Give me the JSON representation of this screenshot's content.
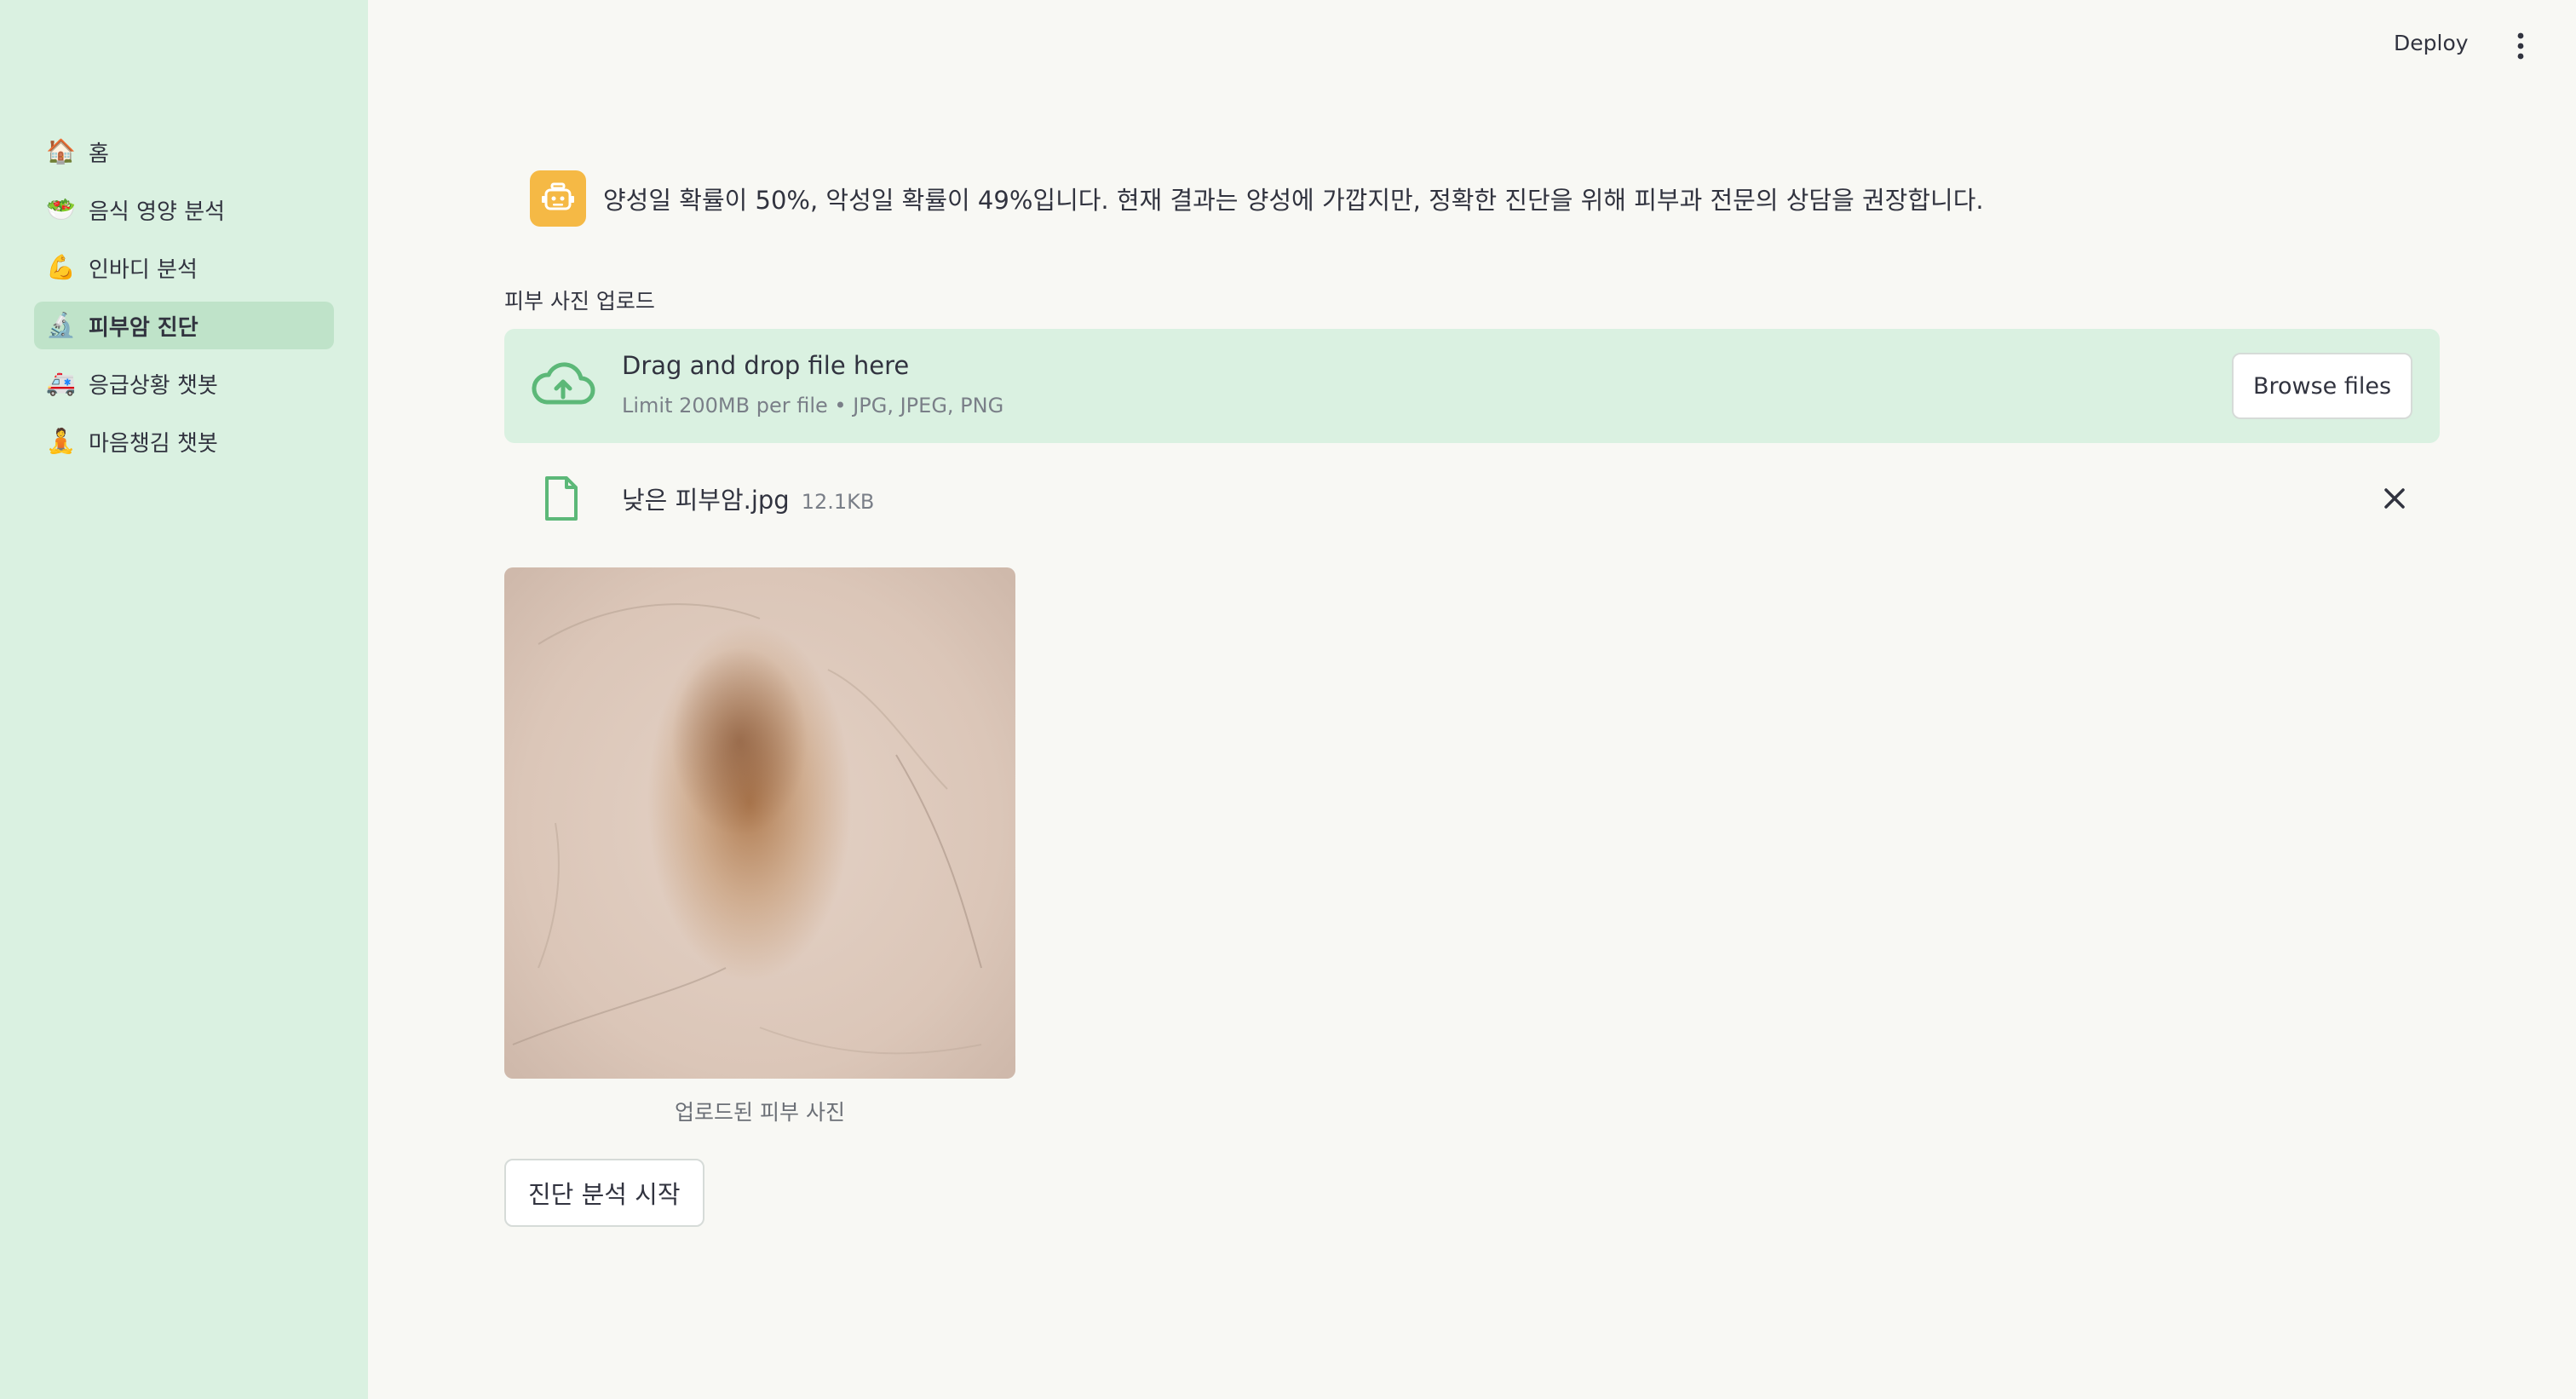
{
  "sidebar": {
    "items": [
      {
        "icon": "house-emoji",
        "glyph": "🏠",
        "label": "홈",
        "active": false
      },
      {
        "icon": "salad-bowl-emoji",
        "glyph": "🥗",
        "label": "음식 영양 분석",
        "active": false
      },
      {
        "icon": "flexed-bicep-emoji",
        "glyph": "💪",
        "label": "인바디 분석",
        "active": false
      },
      {
        "icon": "microscope-emoji",
        "glyph": "🔬",
        "label": "피부암 진단",
        "active": true
      },
      {
        "icon": "ambulance-emoji",
        "glyph": "🚑",
        "label": "응급상황 챗봇",
        "active": false
      },
      {
        "icon": "person-meditating-emoji",
        "glyph": "🧘",
        "label": "마음챙김 챗봇",
        "active": false
      }
    ]
  },
  "header": {
    "deploy_label": "Deploy"
  },
  "assistant": {
    "message": "양성일 확률이 50%, 악성일 확률이 49%입니다. 현재 결과는 양성에 가깝지만, 정확한 진단을 위해 피부과 전문의 상담을 권장합니다."
  },
  "uploader": {
    "label": "피부 사진 업로드",
    "drop_title": "Drag and drop file here",
    "limit_text": "Limit 200MB per file • JPG, JPEG, PNG",
    "browse_label": "Browse files"
  },
  "uploaded_file": {
    "name": "낮은 피부암.jpg",
    "size": "12.1KB"
  },
  "image": {
    "caption": "업로드된 피부 사진"
  },
  "actions": {
    "diagnose_label": "진단 분석 시작"
  },
  "colors": {
    "sidebar_bg": "#daf1e1",
    "active_item_bg": "#bfe3c9",
    "page_bg": "#f8f8f4",
    "dropzone_bg": "#daf1e1",
    "accent_green": "#5cb878",
    "bot_avatar": "#f5b945"
  }
}
